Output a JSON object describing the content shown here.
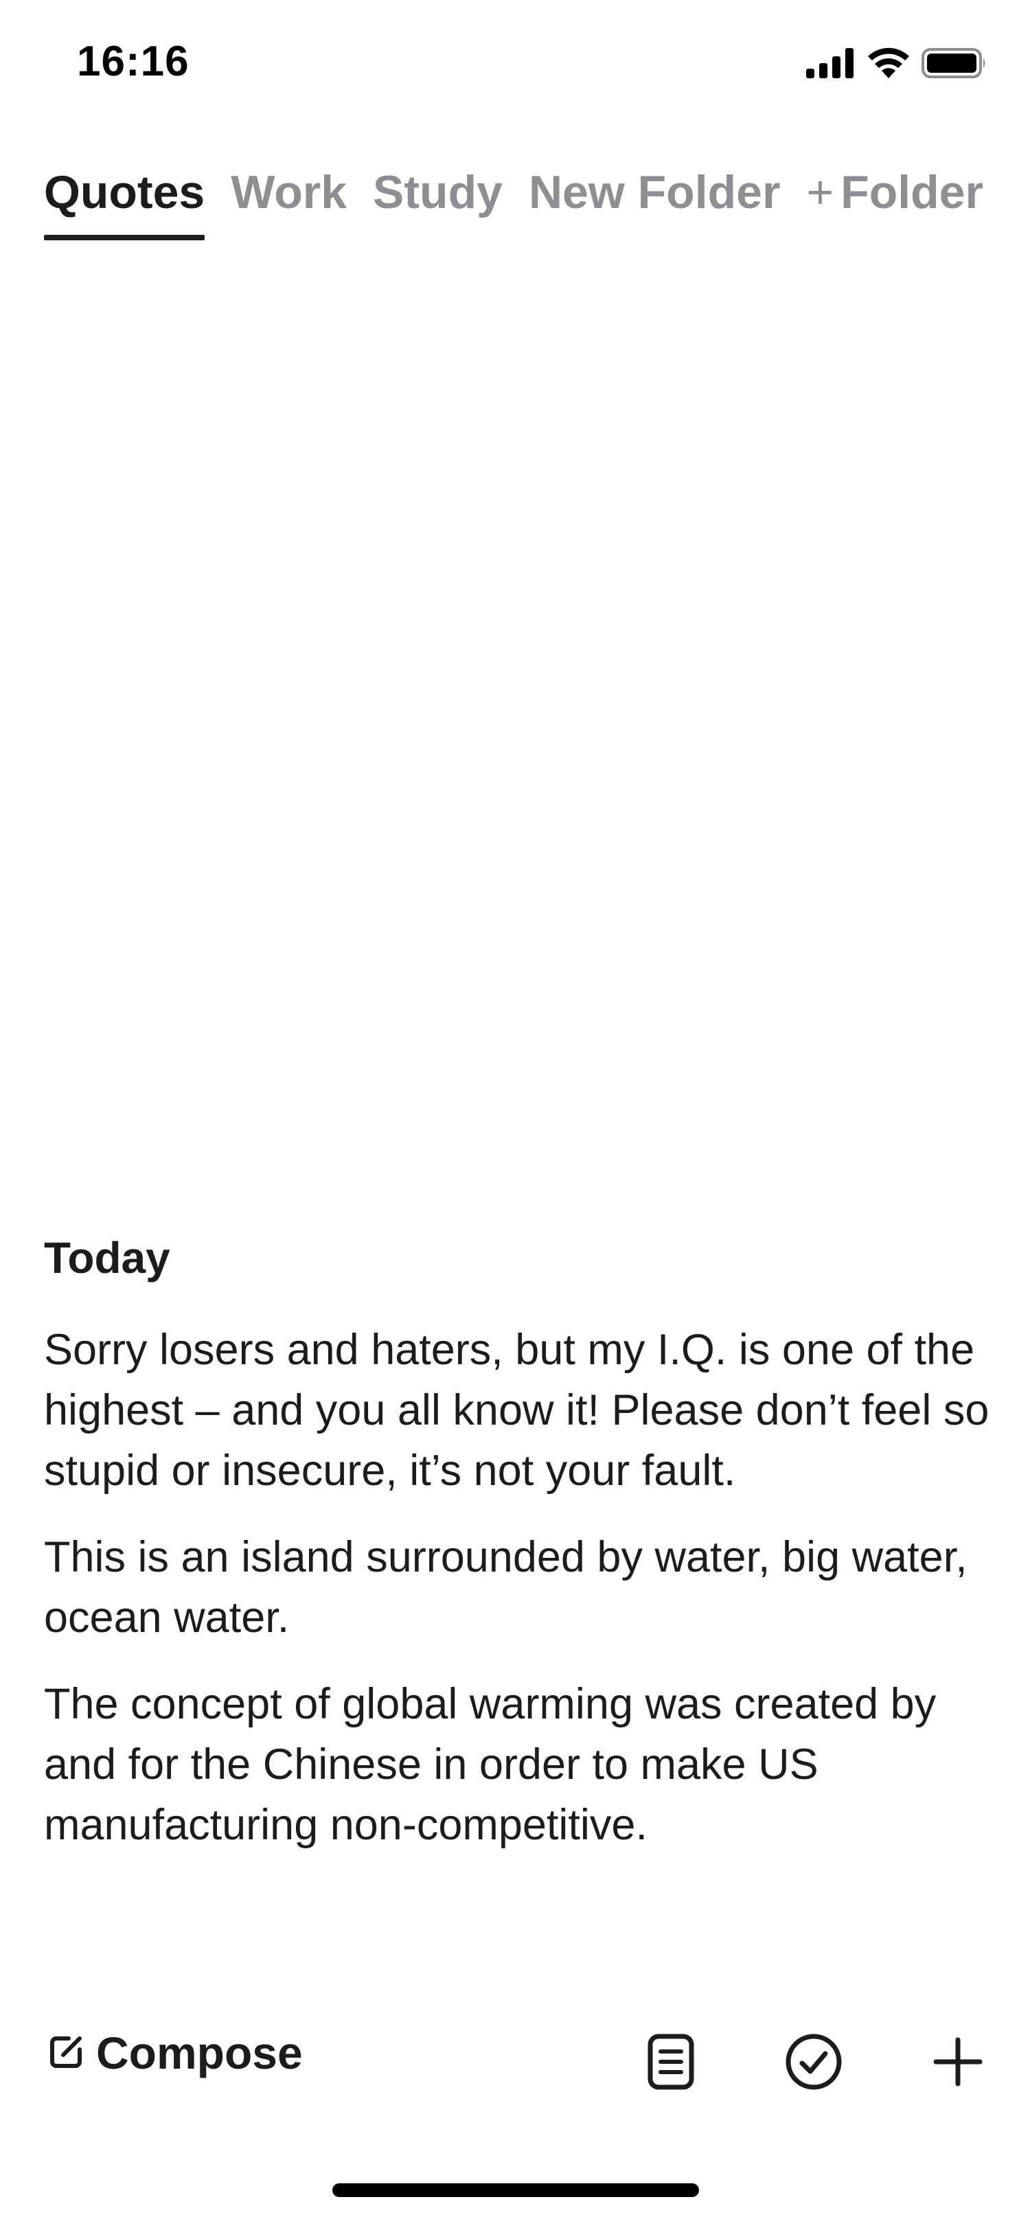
{
  "status_bar": {
    "time": "16:16",
    "icons": [
      "cellular-signal-icon",
      "wifi-icon",
      "battery-icon"
    ]
  },
  "folders": {
    "tabs": [
      {
        "label": "Quotes",
        "active": true
      },
      {
        "label": "Work",
        "active": false
      },
      {
        "label": "Study",
        "active": false
      },
      {
        "label": "New Folder",
        "active": false
      }
    ],
    "add_folder": {
      "icon": "plus",
      "label": "Folder"
    }
  },
  "notes": {
    "section_title": "Today",
    "items": [
      {
        "text": "Sorry losers and haters, but my I.Q. is one of the highest – and you all know it! Please don’t feel so stupid or insecure, it’s not your fault."
      },
      {
        "text": "This is an island surrounded by water, big water, ocean water."
      },
      {
        "text": "The concept of global warming was created by and  for the Chinese in order to make US manufacturing non-competitive."
      }
    ]
  },
  "toolbar": {
    "compose_label": "Compose",
    "compose_icon": "compose-icon",
    "buttons": [
      "note-list-icon",
      "checkmark-circle-icon",
      "plus-icon"
    ]
  },
  "colors": {
    "text_primary": "#1c1c1e",
    "text_inactive": "#8e8e93",
    "background": "#ffffff"
  }
}
